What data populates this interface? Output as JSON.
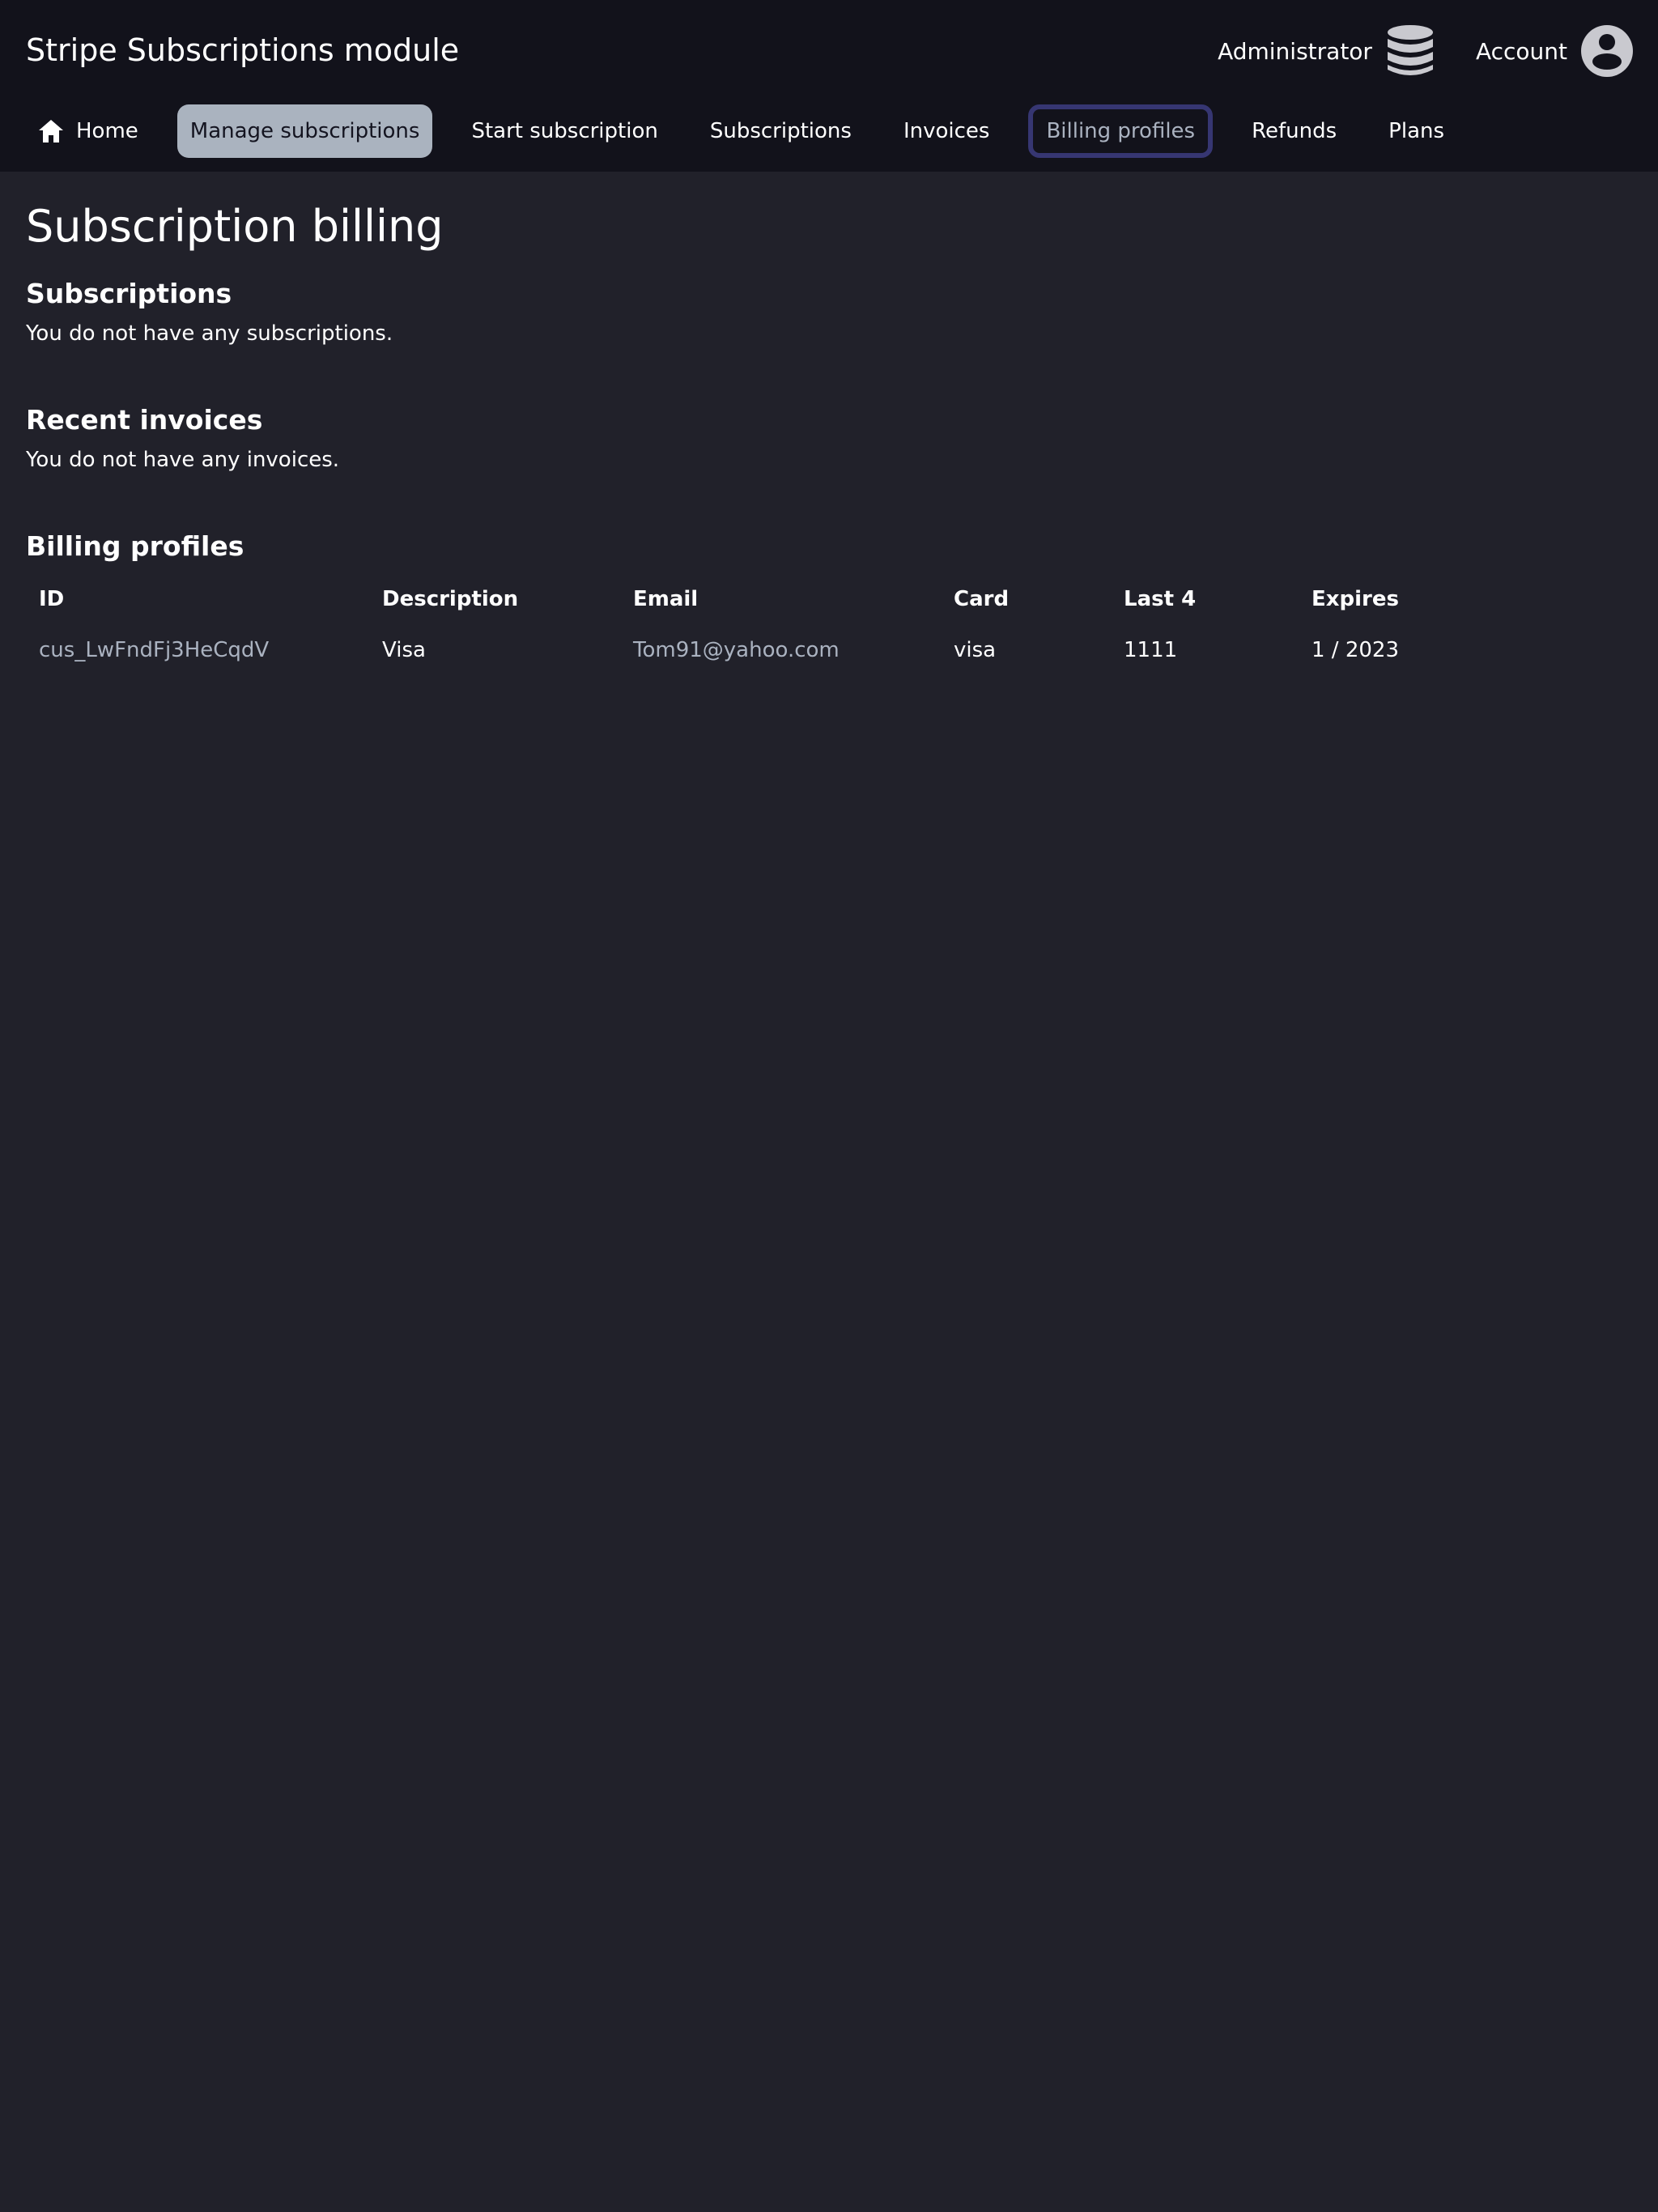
{
  "app": {
    "title": "Stripe Subscriptions module"
  },
  "user": {
    "admin_label": "Administrator",
    "admin_icon": "database-icon",
    "account_label": "Account",
    "account_icon": "account-circle-icon"
  },
  "nav": {
    "items": [
      {
        "label": "Home",
        "icon": "home-icon"
      },
      {
        "label": "Manage subscriptions"
      },
      {
        "label": "Start subscription"
      },
      {
        "label": "Subscriptions"
      },
      {
        "label": "Invoices"
      },
      {
        "label": "Billing profiles"
      },
      {
        "label": "Refunds"
      },
      {
        "label": "Plans"
      }
    ],
    "active_index": 1,
    "focused_index": 5
  },
  "page": {
    "title": "Subscription billing"
  },
  "subscriptions": {
    "title": "Subscriptions",
    "empty_text": "You do not have any subscriptions."
  },
  "invoices": {
    "title": "Recent invoices",
    "empty_text": "You do not have any invoices."
  },
  "billing_profiles": {
    "title": "Billing profiles",
    "columns": [
      "ID",
      "Description",
      "Email",
      "Card",
      "Last 4",
      "Expires"
    ],
    "rows": [
      {
        "id": "cus_LwFndFj3HeCqdV",
        "description": "Visa",
        "email": "Tom91@yahoo.com",
        "card": "visa",
        "last4": "1111",
        "expires": "1 / 2023"
      }
    ]
  },
  "colors": {
    "header_bg": "#12121b",
    "page_bg": "#21212a",
    "active_tab_bg": "#aab3bf",
    "focus_ring": "#363672",
    "link": "#aab2c0"
  }
}
